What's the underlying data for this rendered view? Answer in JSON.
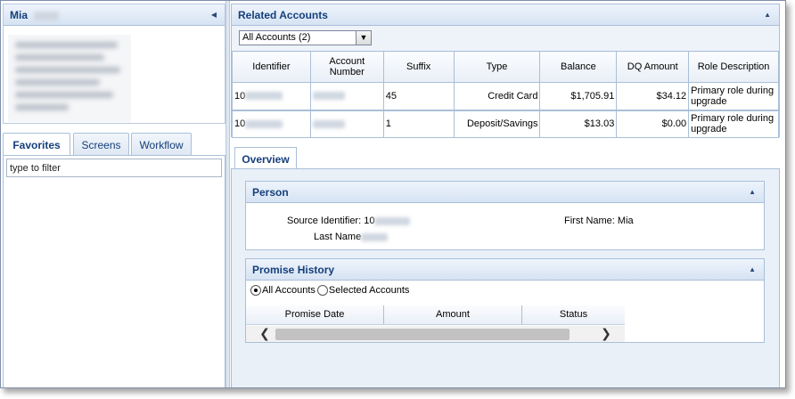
{
  "left": {
    "title": "Mia",
    "tabs": [
      {
        "label": "Favorites"
      },
      {
        "label": "Screens"
      },
      {
        "label": "Workflow"
      }
    ],
    "filter_placeholder": "type to filter"
  },
  "related": {
    "title": "Related Accounts",
    "select_value": "All Accounts (2)",
    "columns": [
      "Identifier",
      "Account Number",
      "Suffix",
      "Type",
      "Balance",
      "DQ Amount",
      "Role Description"
    ],
    "rows": [
      {
        "identifier": "10",
        "suffix": "45",
        "type": "Credit Card",
        "balance": "$1,705.91",
        "dq": "$34.12",
        "role": "Primary role during upgrade"
      },
      {
        "identifier": "10",
        "suffix": "1",
        "type": "Deposit/Savings",
        "balance": "$13.03",
        "dq": "$0.00",
        "role": "Primary role during upgrade"
      }
    ]
  },
  "overview": {
    "tab_label": "Overview",
    "person": {
      "title": "Person",
      "source_label": "Source Identifier:",
      "source_value": "10",
      "first_label": "First Name:",
      "first_value": "Mia",
      "last_label": "Last Name"
    },
    "promise": {
      "title": "Promise History",
      "radio_all": "All Accounts",
      "radio_selected": "Selected Accounts",
      "columns": [
        "Promise Date",
        "Amount",
        "Status"
      ]
    }
  }
}
